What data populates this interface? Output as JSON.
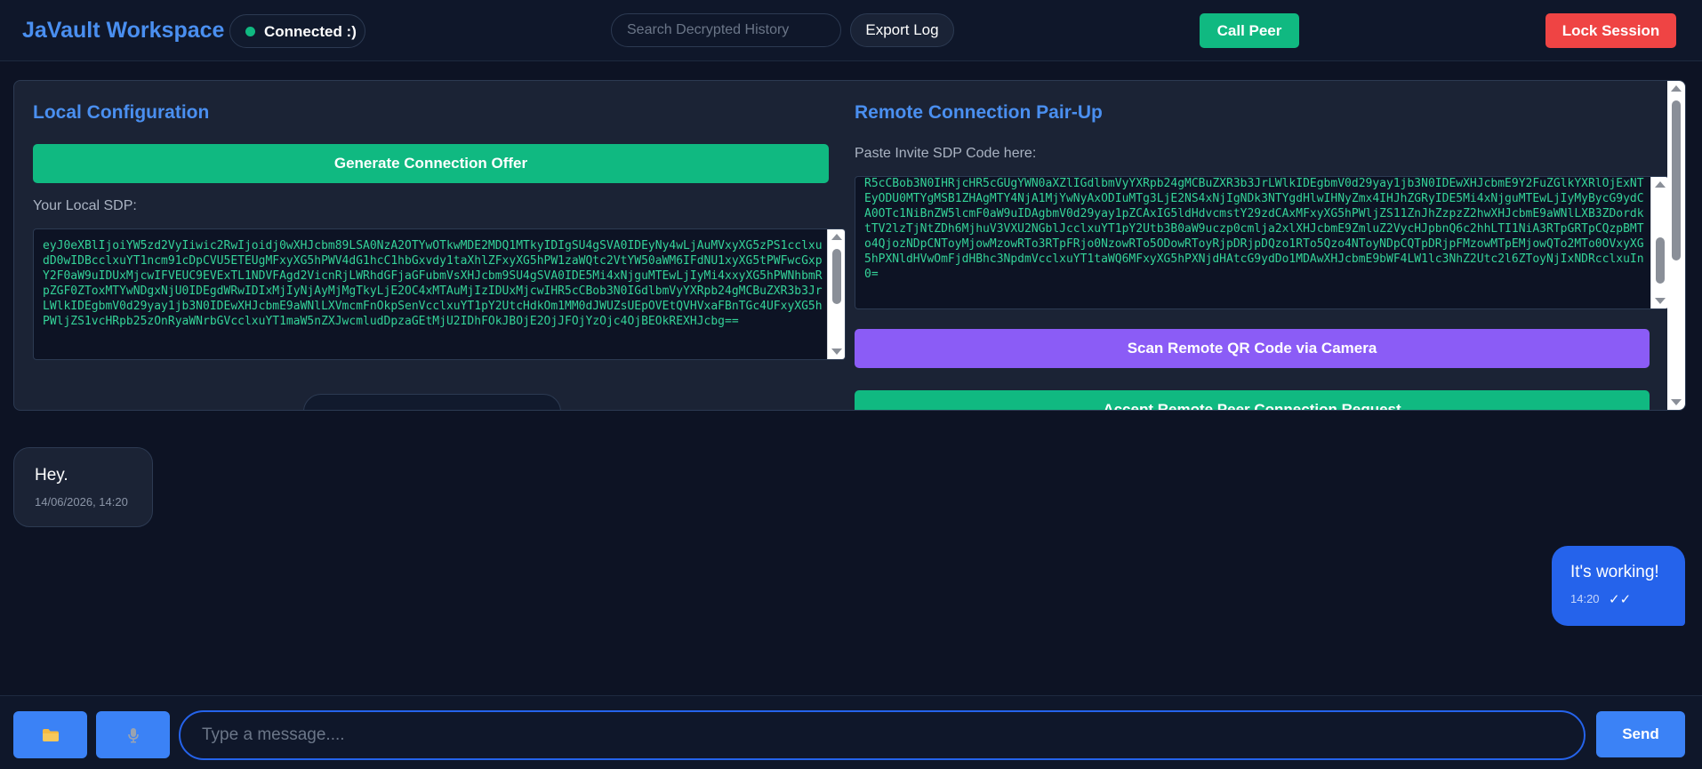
{
  "header": {
    "title": "JaVault Workspace",
    "status": "Connected :)",
    "search_placeholder": "Search Decrypted History",
    "export_label": "Export Log",
    "call_label": "Call Peer",
    "lock_label": "Lock Session"
  },
  "local": {
    "title": "Local Configuration",
    "generate_label": "Generate Connection Offer",
    "sdp_label": "Your Local SDP:",
    "sdp_value": "eyJ0eXBlIjoiYW5zd2VyIiwic2RwIjoidj0wXHJcbm89LSA0NzA2OTYwOTkwMDE2MDQ1MTkyIDIgSU4gSVA0IDEyNy4wLjAuMVxyXG5zPS1cclxudD0wIDBcclxuYT1ncm91cDpCVU5ETEUgMFxyXG5hPWV4dG1hcC1hbGxvdy1taXhlZFxyXG5hPW1zaWQtc2VtYW50aWM6IFdNU1xyXG5tPWFwcGxpY2F0aW9uIDUxMjcwIFVEUC9EVExTL1NDVFAgd2VicnRjLWRhdGFjaGFubmVsXHJcbm9SU4gSVA0IDE5Mi4xNjguMTEwLjIyMi4xxyXG5hPWNhbmRpZGF0ZToxMTYwNDgxNjU0IDEgdWRwIDIxMjIyNjAyMjMgTkyLjE2OC4xMTAuMjIzIDUxMjcwIHR5cCBob3N0IGdlbmVyYXRpb24gMCBuZXR3b3JrLWlkIDEgbmV0d29yay1jb3N0IDEwXHJcbmE9aWNlLXVmcmFnOkpSenVcclxuYT1pY2UtcHdkOm1MM0dJWUZsUEpOVEtQVHVxaFBnTGc4UFxyXG5hPWljZS1vcHRpb25zOnRyaWNrbGVcclxuYT1maW5nZXJwcmludDpzaGEtMjU2IDhFOkJBOjE2OjJFOjYzOjc4OjBEOkREXHJcbg==",
    "sdp_hidden_label": ""
  },
  "remote": {
    "title": "Remote Connection Pair-Up",
    "sdp_label": "Paste Invite SDP Code here:",
    "sdp_value": "R5cCBob3N0IHRjcHR5cGUgYWN0aXZlIGdlbmVyYXRpb24gMCBuZXR3b3JrLWlkIDEgbmV0d29yay1jb3N0IDEwXHJcbmE9Y2FuZGlkYXRlOjExNTEyODU0MTYgMSB1ZHAgMTY4NjA1MjYwNyAxODIuMTg3LjE2NS4xNjIgNDk3NTYgdHlwIHNyZmx4IHJhZGRyIDE5Mi4xNjguMTEwLjIyMyBycG9ydCA0OTc1NiBnZW5lcmF0aW9uIDAgbmV0d29yay1pZCAxIG5ldHdvcmstY29zdCAxMFxyXG5hPWljZS11ZnJhZzpzZ2hwXHJcbmE9aWNlLXB3ZDordktTV2lzTjNtZDh6MjhuV3VXU2NGblJcclxuYT1pY2Utb3B0aW9uczp0cmlja2xlXHJcbmE9ZmluZ2VycHJpbnQ6c2hhLTI1NiA3RTpGRTpCQzpBMTo4QjozNDpCNToyMjowMzowRTo3RTpFRjo0NzowRTo5ODowRToyRjpDRjpDQzo1RTo5Qzo4NToyNDpCQTpDRjpFMzowMTpEMjowQTo2MTo0OVxyXG5hPXNldHVwOmFjdHBhc3NpdmVcclxuYT1taWQ6MFxyXG5hPXNjdHAtcG9ydDo1MDAwXHJcbmE9bWF4LW1lc3NhZ2Utc2l6ZToyNjIxNDRcclxuIn0=",
    "qr_label": "Scan Remote QR Code via Camera",
    "accept_label": "Accept Remote Peer Connection Request"
  },
  "messages": [
    {
      "text": "Hey.",
      "time": "14/06/2026, 14:20",
      "direction": "incoming"
    },
    {
      "text": "It's working!",
      "time": "14:20",
      "ticks": "✓✓",
      "direction": "outgoing"
    }
  ],
  "composer": {
    "placeholder": "Type a message....",
    "send_label": "Send",
    "folder_icon": "folder-icon",
    "mic_icon": "microphone-icon"
  },
  "colors": {
    "accent": "#3b82f6",
    "brand_title": "#4a8ff0",
    "success": "#10b981",
    "danger": "#ef4444",
    "purple": "#8b5cf6",
    "sdp_text": "#34d399"
  }
}
